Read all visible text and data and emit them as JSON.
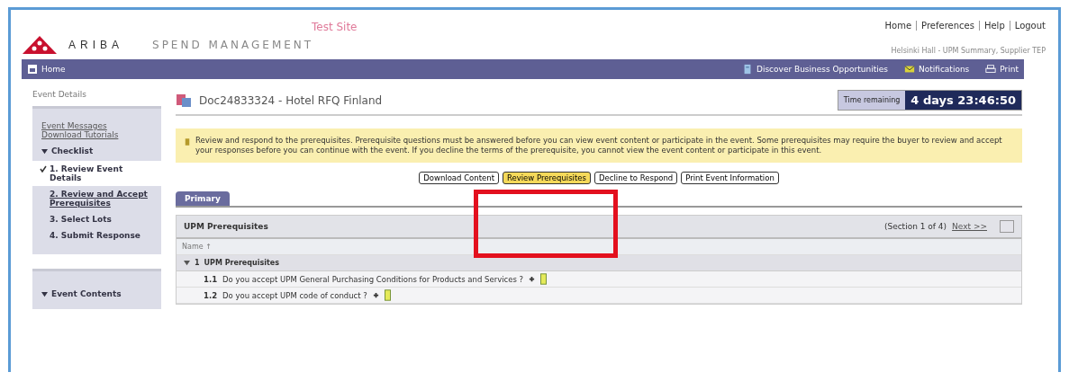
{
  "header": {
    "brand": "ARIBA",
    "product": "SPEND MANAGEMENT",
    "site_label": "Test Site",
    "top_links": [
      "Home",
      "Preferences",
      "Help",
      "Logout"
    ],
    "user_line": "Helsinki Hall - UPM Summary, Supplier TEP"
  },
  "nav": {
    "home": "Home",
    "items": [
      {
        "label": "Discover Business Opportunities",
        "kind": "discover"
      },
      {
        "label": "Notifications",
        "kind": "notifications"
      },
      {
        "label": "Print",
        "kind": "print"
      }
    ]
  },
  "sidebar": {
    "title": "Event Details",
    "links": [
      "Event Messages",
      "Download Tutorials"
    ],
    "checklist": {
      "label": "Checklist",
      "expanded": true,
      "items": [
        {
          "label": "1. Review Event Details",
          "selected": true,
          "checked": true
        },
        {
          "label": "2. Review and Accept Prerequisites",
          "selected": false,
          "checked": false
        },
        {
          "label": "3. Select Lots",
          "selected": false,
          "checked": false
        },
        {
          "label": "4. Submit Response",
          "selected": false,
          "checked": false
        }
      ]
    },
    "contents": {
      "label": "Event Contents",
      "expanded": true
    }
  },
  "event": {
    "title": "Doc24833324 - Hotel RFQ Finland",
    "time_label": "Time remaining",
    "time_value": "4 days 23:46:50"
  },
  "message": "Review and respond to the prerequisites. Prerequisite questions must be answered before you can view event content or participate in the event. Some prerequisites may require the buyer to review and accept your responses before you can continue with the event. If you decline the terms of the prerequisite, you cannot view the event content or participate in this event.",
  "buttons": [
    {
      "label": "Download Content",
      "selected": false
    },
    {
      "label": "Review Prerequisites",
      "selected": true
    },
    {
      "label": "Decline to Respond",
      "selected": false
    },
    {
      "label": "Print Event Information",
      "selected": false
    }
  ],
  "tabs": [
    {
      "label": "Primary",
      "selected": true
    }
  ],
  "section": {
    "title": "UPM Prerequisites",
    "position": "(Section 1 of 4)",
    "next": "Next >>",
    "column": "Name ↑",
    "group": {
      "number": "1",
      "label": "UPM Prerequisites",
      "expanded": true
    },
    "rows": [
      {
        "number": "1.1",
        "question": "Do you accept UPM General Purchasing Conditions for Products and Services ?"
      },
      {
        "number": "1.2",
        "question": "Do you accept UPM code of conduct ?"
      }
    ]
  }
}
